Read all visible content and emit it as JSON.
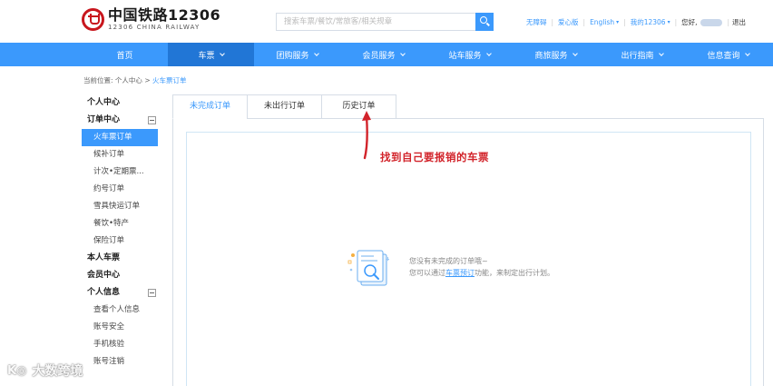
{
  "header": {
    "logo_cn": "中国铁路12306",
    "logo_en": "12306 CHINA RAILWAY",
    "search_placeholder": "搜索车票/餐饮/常旅客/相关规章",
    "links": {
      "accessible": "无障碍",
      "care": "爱心版",
      "english": "English",
      "my12306": "我的12306",
      "greeting": "您好,",
      "logout": "退出"
    }
  },
  "nav": {
    "items": [
      {
        "label": "首页",
        "active": false,
        "has_menu": false
      },
      {
        "label": "车票",
        "active": true,
        "has_menu": true
      },
      {
        "label": "团购服务",
        "active": false,
        "has_menu": true
      },
      {
        "label": "会员服务",
        "active": false,
        "has_menu": true
      },
      {
        "label": "站车服务",
        "active": false,
        "has_menu": true
      },
      {
        "label": "商旅服务",
        "active": false,
        "has_menu": true
      },
      {
        "label": "出行指南",
        "active": false,
        "has_menu": true
      },
      {
        "label": "信息查询",
        "active": false,
        "has_menu": true
      }
    ]
  },
  "breadcrumb": {
    "prefix": "当前位置:",
    "level1": "个人中心",
    "separator": ">",
    "current": "火车票订单"
  },
  "sidebar": {
    "personal_center": "个人中心",
    "order_center": "订单中心",
    "order_items": [
      "火车票订单",
      "候补订单",
      "计次•定期票...",
      "约号订单",
      "雪具快运订单",
      "餐饮•特产",
      "保险订单"
    ],
    "my_tickets": "本人车票",
    "member_center": "会员中心",
    "personal_info": "个人信息",
    "info_items": [
      "查看个人信息",
      "账号安全",
      "手机核验",
      "账号注销"
    ]
  },
  "tabs": [
    "未完成订单",
    "未出行订单",
    "历史订单"
  ],
  "annotation": "找到自己要报销的车票",
  "empty_state": {
    "line1": "您没有未完成的订单哦~",
    "line2_prefix": "您可以通过",
    "line2_link": "车票预订",
    "line2_suffix": "功能，来制定出行计划。"
  },
  "watermark": "大数跨境",
  "colors": {
    "primary": "#3b99fc",
    "nav_active": "#2176d6",
    "annotation_red": "#d2232a",
    "logo_red": "#c8161d"
  }
}
